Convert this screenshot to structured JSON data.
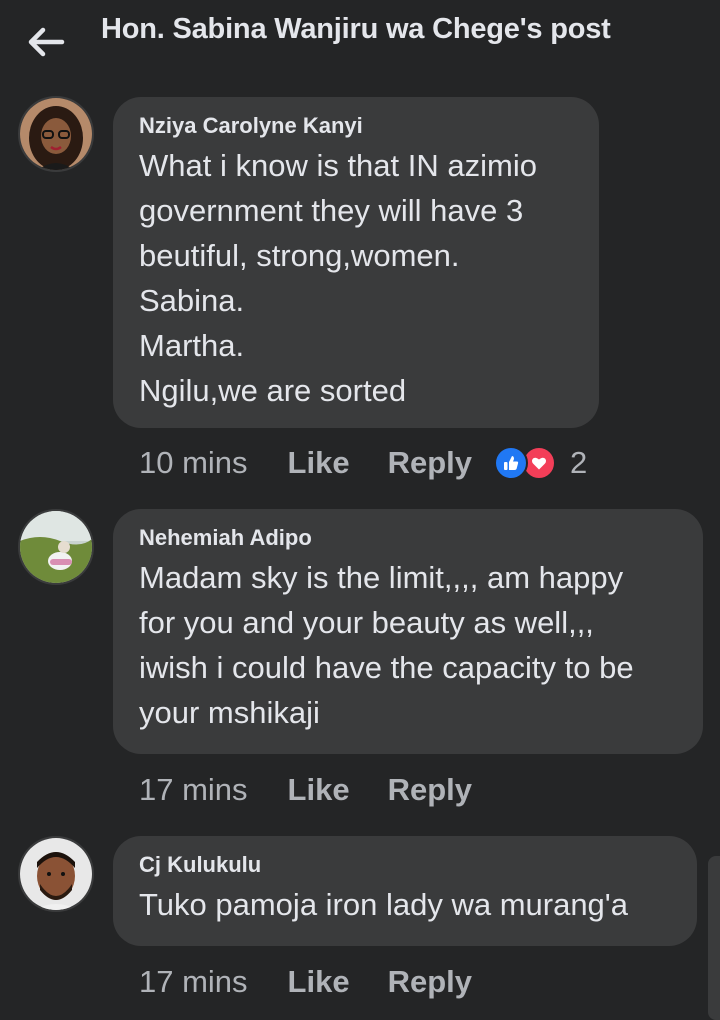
{
  "header": {
    "title": "Hon. Sabina Wanjiru wa Chege's post"
  },
  "comments": [
    {
      "author": "Nziya Carolyne Kanyi",
      "text": "What i know is that IN azimio\ngovernment they will have 3\nbeutiful, strong,women.\nSabina.\nMartha.\nNgilu,we are sorted",
      "time": "10 mins",
      "like_label": "Like",
      "reply_label": "Reply",
      "reactions": [
        "like-icon",
        "love-icon"
      ],
      "reaction_count": "2"
    },
    {
      "author": "Nehemiah Adipo",
      "text": "Madam sky is the limit,,,, am happy\nfor you and your beauty as well,,,\niwish i could have the capacity to be\nyour mshikaji",
      "time": "17 mins",
      "like_label": "Like",
      "reply_label": "Reply"
    },
    {
      "author": "Cj Kulukulu",
      "text": "Tuko pamoja iron lady wa murang'a",
      "time": "17 mins",
      "like_label": "Like",
      "reply_label": "Reply"
    }
  ],
  "colors": {
    "background": "#242526",
    "bubble": "#3a3b3c",
    "text": "#e4e6eb",
    "secondary_text": "#b0b3b8",
    "like_blue": "#2078f4",
    "love_red": "#f33e58"
  }
}
